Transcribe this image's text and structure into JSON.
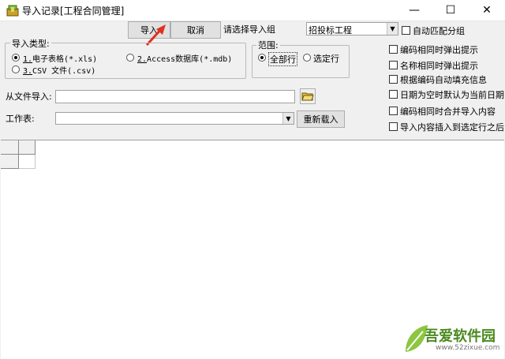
{
  "window": {
    "title": "导入记录[工程合同管理]",
    "minimize": "—",
    "maximize": "☐",
    "close": "✕"
  },
  "toolbar": {
    "import_label": "导入",
    "cancel_label": "取消"
  },
  "group_select": {
    "label": "请选择导入组",
    "value": "招投标工程"
  },
  "import_type": {
    "legend": "导入类型:",
    "options": [
      {
        "key": "1.",
        "label": "电子表格(*.xls)",
        "selected": true
      },
      {
        "key": "2.",
        "label": "Access数据库(*.mdb)",
        "selected": false
      },
      {
        "key": "3.",
        "label": "CSV 文件(.csv)",
        "selected": false
      }
    ]
  },
  "range": {
    "legend": "范围:",
    "options": [
      {
        "label": "全部行",
        "selected": true
      },
      {
        "label": "选定行",
        "selected": false
      }
    ]
  },
  "from_file": {
    "label": "从文件导入:",
    "value": ""
  },
  "worksheet": {
    "label": "工作表:",
    "value": "",
    "reload_label": "重新载入"
  },
  "options": [
    {
      "label": "自动匹配分组",
      "checked": false
    },
    {
      "label": "编码相同时弹出提示",
      "checked": false
    },
    {
      "label": "名称相同时弹出提示",
      "checked": false
    },
    {
      "label": "根据编码自动填充信息",
      "checked": false
    },
    {
      "label": "日期为空时默认为当前日期",
      "checked": false
    },
    {
      "label": "编码相同时合并导入内容",
      "checked": false
    },
    {
      "label": "导入内容插入到选定行之后",
      "checked": false
    }
  ],
  "watermark": {
    "text": "吾爱软件园",
    "url": "www.52zixue.com"
  },
  "colors": {
    "annotation_arrow": "#e03020",
    "window_bg": "#f0f0f0"
  }
}
